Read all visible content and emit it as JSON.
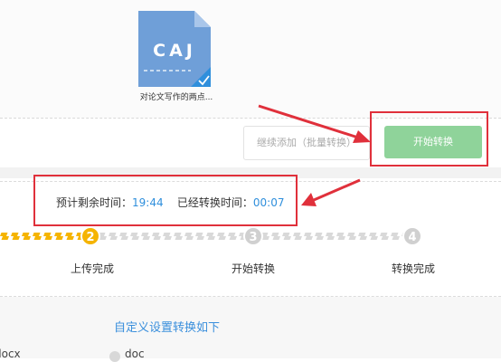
{
  "file": {
    "icon_text": "CAJ",
    "name": "对论文写作的两点...",
    "status_icon": "checkmark-icon"
  },
  "actions": {
    "add_label": "继续添加（批量转换）",
    "start_label": "开始转换"
  },
  "timing": {
    "remaining_label": "预计剩余时间：",
    "remaining_value": "19:44",
    "elapsed_label": "已经转换时间：",
    "elapsed_value": "00:07"
  },
  "progress": {
    "steps": [
      {
        "number": "2",
        "label": "上传完成",
        "state": "done"
      },
      {
        "number": "3",
        "label": "开始转换",
        "state": "pending"
      },
      {
        "number": "4",
        "label": "转换完成",
        "state": "pending"
      }
    ]
  },
  "settings": {
    "title": "自定义设置转换如下",
    "options": [
      "docx",
      "doc"
    ]
  },
  "colors": {
    "accent_blue": "#2f8fdc",
    "progress_yellow": "#f5b400",
    "start_green": "#8fd39a",
    "annotation_red": "#e0303b",
    "file_icon_blue": "#6f9fd8"
  }
}
